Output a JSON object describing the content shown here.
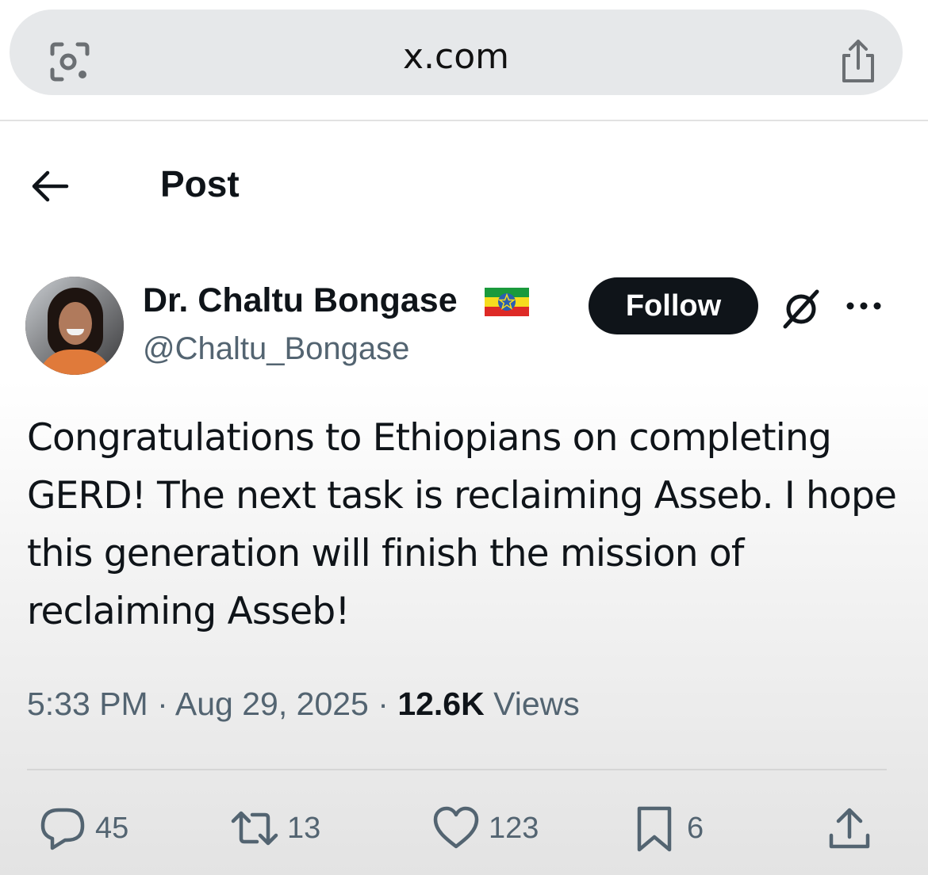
{
  "browser": {
    "url": "x.com",
    "icons": {
      "left": "lens-camera-icon",
      "right": "share-icon"
    }
  },
  "header": {
    "title": "Post",
    "back_icon": "back-arrow-icon"
  },
  "author": {
    "display_name": "Dr. Chaltu Bongase",
    "handle": "@Chaltu_Bongase",
    "flag_icon": "ethiopia-flag-icon"
  },
  "actions_top": {
    "follow_label": "Follow",
    "grok_icon": "grok-icon",
    "more_icon": "more-icon"
  },
  "tweet": {
    "text": "Congratulations to Ethiopians on completing GERD! The next task is reclaiming Asseb. I hope this generation will finish the mission of reclaiming Asseb!",
    "time": "5:33 PM",
    "date": "Aug 29, 2025",
    "views_count": "12.6K",
    "views_label": "Views"
  },
  "engagement": {
    "replies": "45",
    "reposts": "13",
    "likes": "123",
    "bookmarks": "6"
  },
  "colors": {
    "text": "#0f1419",
    "muted": "#536471",
    "follow_bg": "#0f1419"
  }
}
